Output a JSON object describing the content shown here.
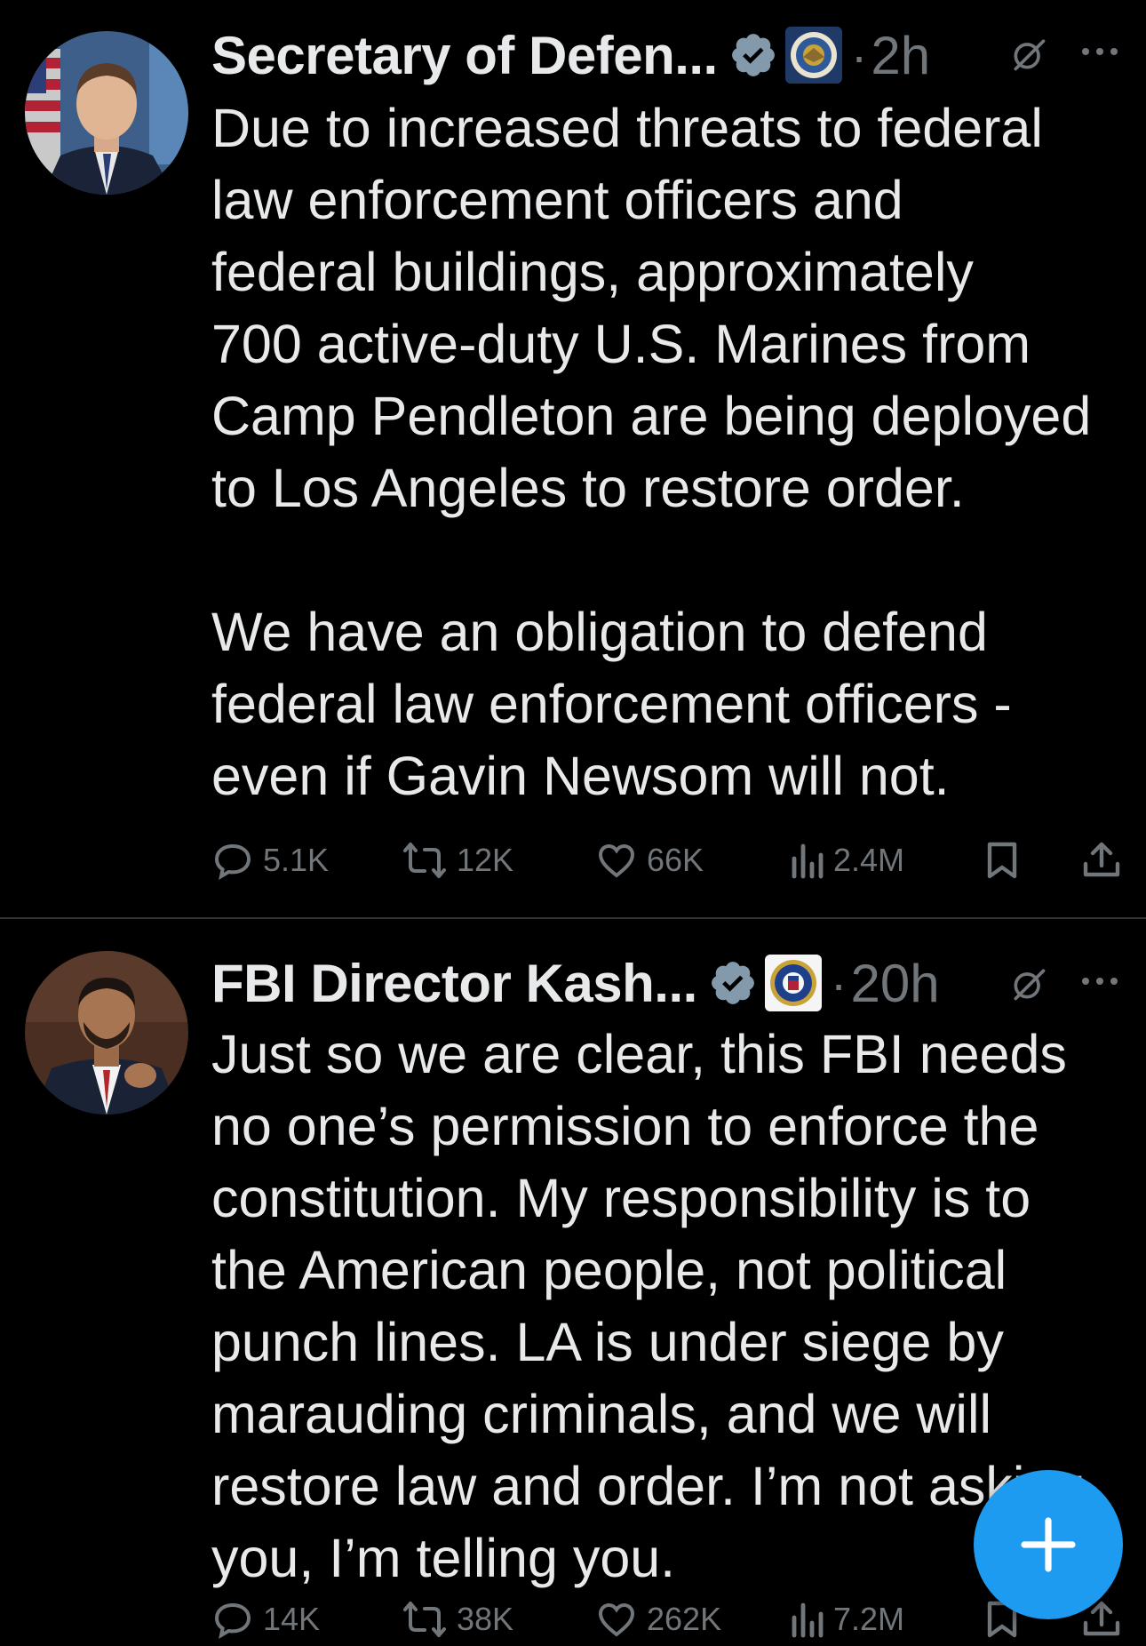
{
  "colors": {
    "background": "#000000",
    "text_primary": "#e7e9ea",
    "text_secondary": "#71767b",
    "verified_badge": "#829aab",
    "accent": "#1d9bf0",
    "divider": "#2f3336"
  },
  "tweets": [
    {
      "author_name": "Secretary of Defen...",
      "verified_icon": "verified-badge-gray",
      "affiliation_icon": "department-of-defense-seal",
      "dot": "·",
      "timestamp": "2h",
      "grok_icon": "grok-icon",
      "more_icon": "more-horizontal-icon",
      "paragraphs": [
        "Due to increased threats to federal\nlaw enforcement officers and\nfederal buildings, approximately\n700 active-duty U.S. Marines from\nCamp Pendleton are being deployed\nto Los Angeles to restore order.",
        "We have an obligation to defend\nfederal law enforcement officers -\neven if Gavin Newsom will not."
      ],
      "counts": {
        "replies": "5.1K",
        "reposts": "12K",
        "likes": "66K",
        "views": "2.4M"
      }
    },
    {
      "author_name": "FBI Director Kash...",
      "verified_icon": "verified-badge-gray",
      "affiliation_icon": "fbi-seal",
      "dot": "·",
      "timestamp": "20h",
      "grok_icon": "grok-icon",
      "more_icon": "more-horizontal-icon",
      "paragraphs": [
        "Just so we are clear, this FBI needs\nno one’s permission to enforce the\nconstitution. My responsibility is to\nthe American people, not political\npunch lines. LA is under siege by\nmarauding criminals, and we will\nrestore law and order. I’m not asking\nyou, I’m telling you."
      ],
      "counts": {
        "replies": "14K",
        "reposts": "38K",
        "likes": "262K",
        "views": "7.2M"
      }
    }
  ],
  "compose_button": {
    "icon": "plus-icon"
  }
}
